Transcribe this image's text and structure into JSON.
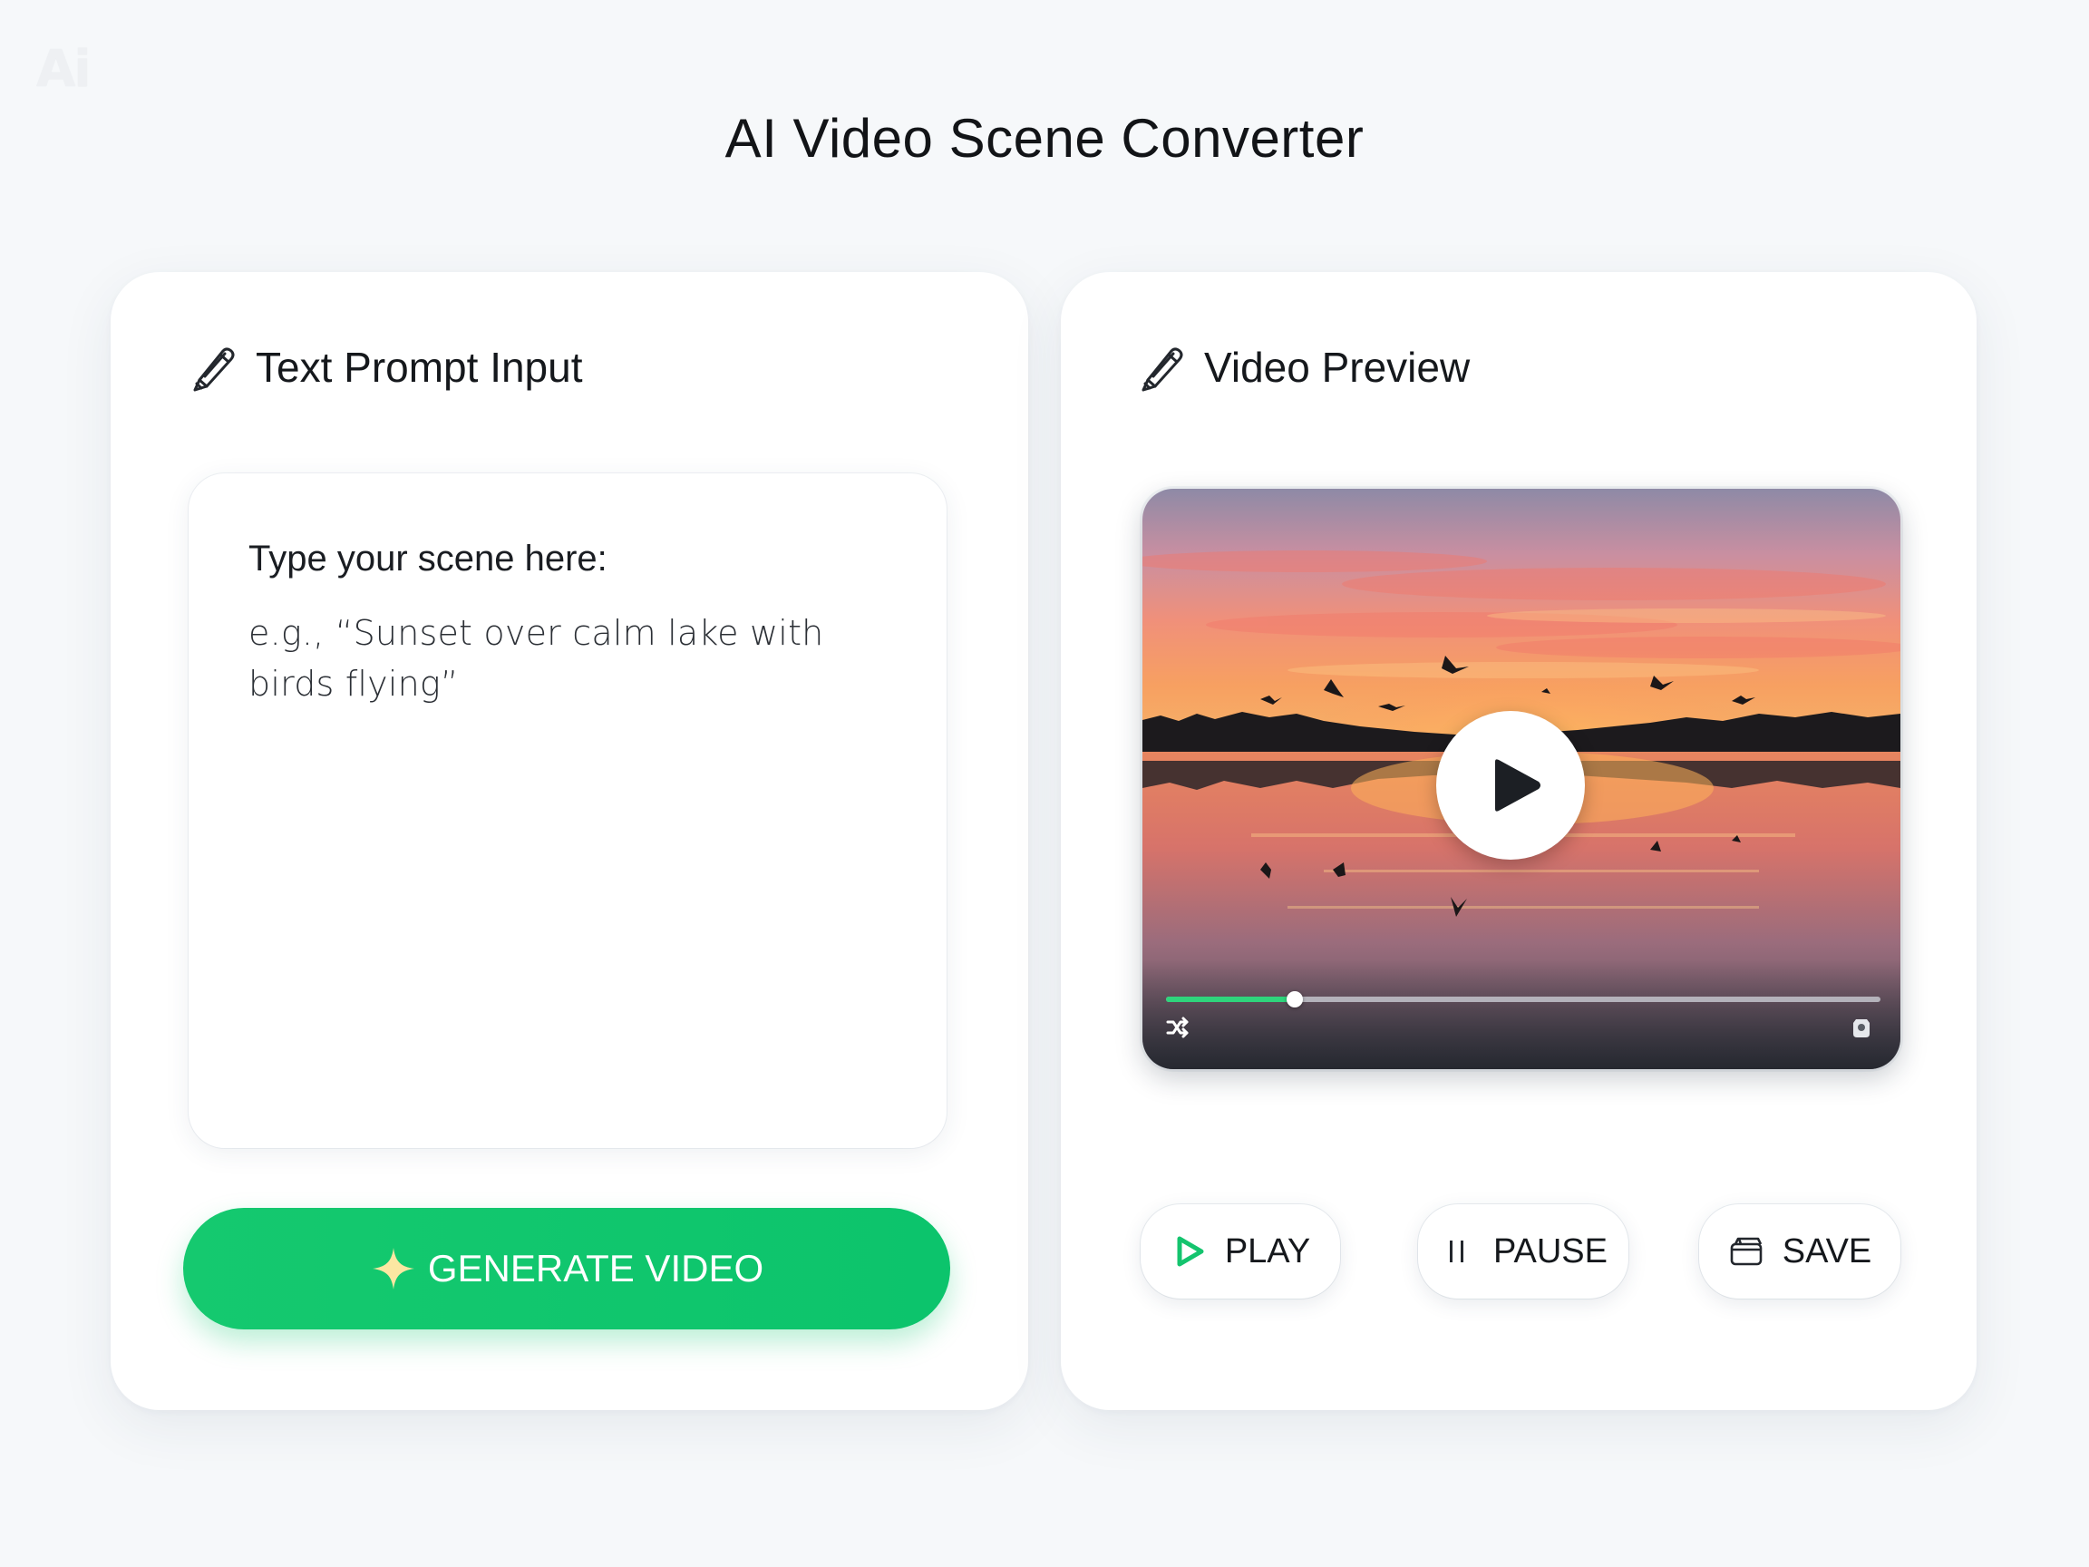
{
  "app": {
    "logo": "Ai",
    "title": "AI Video Scene Converter"
  },
  "input_panel": {
    "heading": "Text Prompt Input",
    "heading_icon": "pencil-icon",
    "prompt_label": "Type your scene here:",
    "prompt_placeholder": "e.g., “Sunset over calm lake with birds flying”",
    "generate_button": {
      "label": "GENERATE VIDEO",
      "icon": "sparkle-icon",
      "color": "#0cc46c"
    }
  },
  "preview_panel": {
    "heading": "Video Preview",
    "heading_icon": "pencil-icon",
    "player": {
      "progress": 0.18,
      "progress_color": "#2fd47c",
      "center_control": "play-icon"
    },
    "controls": {
      "play_label": "PLAY",
      "pause_label": "PAUSE",
      "save_label": "SAVE",
      "play_icon_color": "#14c46e"
    }
  }
}
